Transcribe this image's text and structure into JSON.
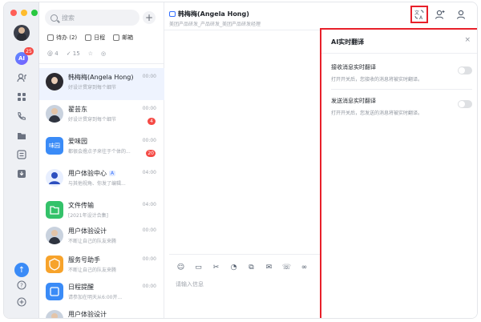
{
  "search": {
    "placeholder": "搜索"
  },
  "filters": {
    "todo": "待办 (2)",
    "calendar": "日程",
    "mail": "邮箱",
    "mention_count": "4",
    "done_count": "15"
  },
  "chats": [
    {
      "name": "韩梅梅(Angela Hong)",
      "preview": "好设计贯穿到每个细节",
      "time": "00:00",
      "badge": ""
    },
    {
      "name": "翟芸东",
      "preview": "好设计贯穿到每个细节",
      "time": "00:00",
      "badge": "4"
    },
    {
      "name": "爱味园",
      "preview": "都很会撸点子来往于个体的...",
      "time": "00:00",
      "badge": "20",
      "avatar_text": "味园"
    },
    {
      "name": "用户体验中心",
      "preview": "与其他视角、你发了编辑...",
      "time": "04:00",
      "badge": "",
      "tag": "A"
    },
    {
      "name": "文件传输",
      "preview": "[2021年设计合集]",
      "time": "04:00",
      "badge": ""
    },
    {
      "name": "用户体验设计",
      "preview": "不断让自己的队友来腾",
      "time": "00:00",
      "badge": ""
    },
    {
      "name": "服务号助手",
      "preview": "不断让自己的队友来腾",
      "time": "00:00",
      "badge": ""
    },
    {
      "name": "日程提醒",
      "preview": "请参加在明天从6:00开...",
      "time": "00:00",
      "badge": ""
    },
    {
      "name": "用户体验设计",
      "preview": "",
      "time": "",
      "badge": ""
    }
  ],
  "chat": {
    "title": "韩梅梅(Angela Hong)",
    "subtitle": "美团产品研发_产品研发_美团产品研发经理",
    "input_placeholder": "请输入信息"
  },
  "panel": {
    "title": "AI实时翻译",
    "close": "×",
    "receive_title": "接收消息实时翻译",
    "receive_desc": "打开开关后，您接收的消息将被实时翻译。",
    "send_title": "发送消息实时翻译",
    "send_desc": "打开开关后，您发送的消息将被实时翻译。",
    "receive_on": false,
    "send_on": false
  },
  "rail": {
    "ai_label": "AI",
    "ai_badge": "25"
  },
  "colors": {
    "accent": "#3370ff",
    "highlight": "#e8202a",
    "badge": "#f54a45"
  }
}
